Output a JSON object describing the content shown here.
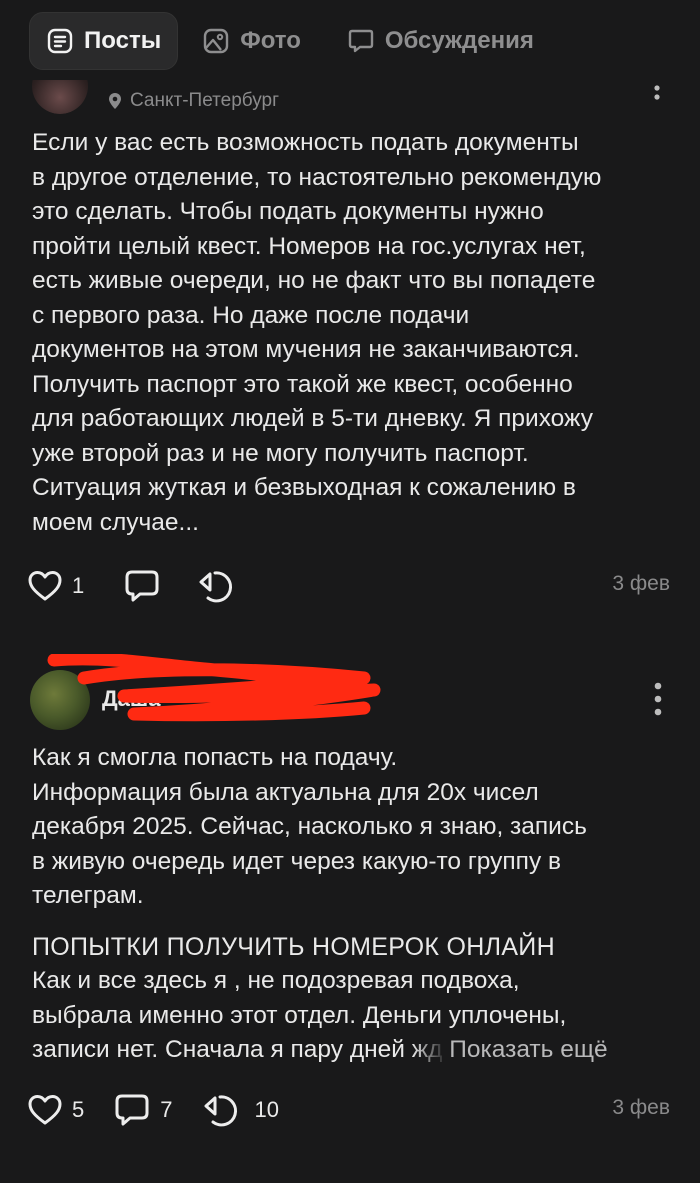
{
  "tabs": [
    {
      "label": "Посты",
      "icon": "posts-icon",
      "active": true
    },
    {
      "label": "Фото",
      "icon": "photo-icon",
      "active": false
    },
    {
      "label": "Обсуждения",
      "icon": "discussions-icon",
      "active": false
    }
  ],
  "post1": {
    "location": "Санкт-Петербург",
    "body": "Если у вас есть возможность подать документы\nв другое отделение, то настоятельно рекомендую\nэто сделать. Чтобы подать документы нужно\nпройти целый квест. Номеров на гос.услугах нет,\nесть живые очереди, но не факт что вы попадете\nс первого раза. Но даже после подачи\nдокументов на этом мучения не заканчиваются.\nПолучить паспорт это такой же квест, особенно\nдля работающих людей в 5-ти дневку. Я прихожу\nуже второй раз и не могу получить паспорт.\nСитуация жуткая и безвыходная к сожалению в\nмоем случае...",
    "likes": "1",
    "date": "3 фев"
  },
  "post2": {
    "author": "Даша",
    "body1": "Как я смогла попасть на подачу.\nИнформация была актуальна для 20х чисел\nдекабря 2025. Сейчас, насколько я знаю, запись\nв живую очередь идет через какую-то группу в\nтелеграм.",
    "heading": "ПОПЫТКИ ПОЛУЧИТЬ НОМЕРОК ОНЛАЙН",
    "body2": "Как и все здесь я , не подозревая подвоха,\nвыбрала именно этот отдел. Деньги уплочены,",
    "body3_start": "записи нет. Сначала я пару дней ",
    "body3_fade": "жд",
    "show_more": "Показать ещё",
    "likes": "5",
    "comments": "7",
    "reposts": "10",
    "date": "3 фев"
  },
  "colors": {
    "background": "#19191a",
    "redact": "#ff2a12"
  }
}
